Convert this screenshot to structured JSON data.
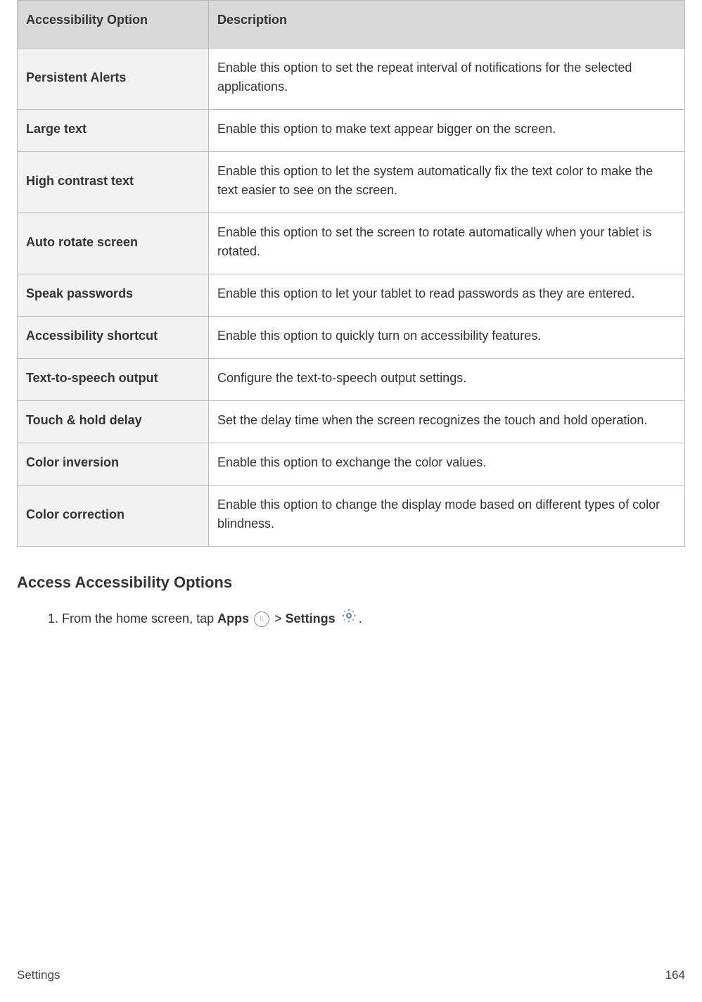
{
  "table": {
    "headers": {
      "option": "Accessibility Option",
      "description": "Description"
    },
    "rows": [
      {
        "option": "Persistent Alerts",
        "description": "Enable this option to set the repeat interval of notifications for the selected applications."
      },
      {
        "option": "Large text",
        "description": "Enable this option to make text appear bigger on the screen."
      },
      {
        "option": "High contrast text",
        "description": "Enable this option to let the system automatically fix the text color to make the text easier to see on the screen."
      },
      {
        "option": "Auto rotate screen",
        "description": "Enable this option to set the screen to rotate automatically when your tablet is rotated."
      },
      {
        "option": "Speak passwords",
        "description": "Enable this option to let your tablet to read passwords as they are entered."
      },
      {
        "option": "Accessibility shortcut",
        "description": "Enable this option to quickly turn on accessibility features."
      },
      {
        "option": "Text-to-speech output",
        "description": "Configure the text-to-speech output settings."
      },
      {
        "option": "Touch & hold delay",
        "description": "Set the delay time when the screen recognizes the touch and hold operation."
      },
      {
        "option": "Color inversion",
        "description": "Enable this option to exchange the color values."
      },
      {
        "option": "Color correction",
        "description": "Enable this option to change the display mode based on different types of color blindness."
      }
    ]
  },
  "section_heading": "Access Accessibility Options",
  "step": {
    "number": "1.",
    "prefix": "From the home screen, tap ",
    "apps_label": "Apps",
    "separator": " > ",
    "settings_label": "Settings",
    "suffix": "."
  },
  "footer": {
    "left": "Settings",
    "right": "164"
  }
}
